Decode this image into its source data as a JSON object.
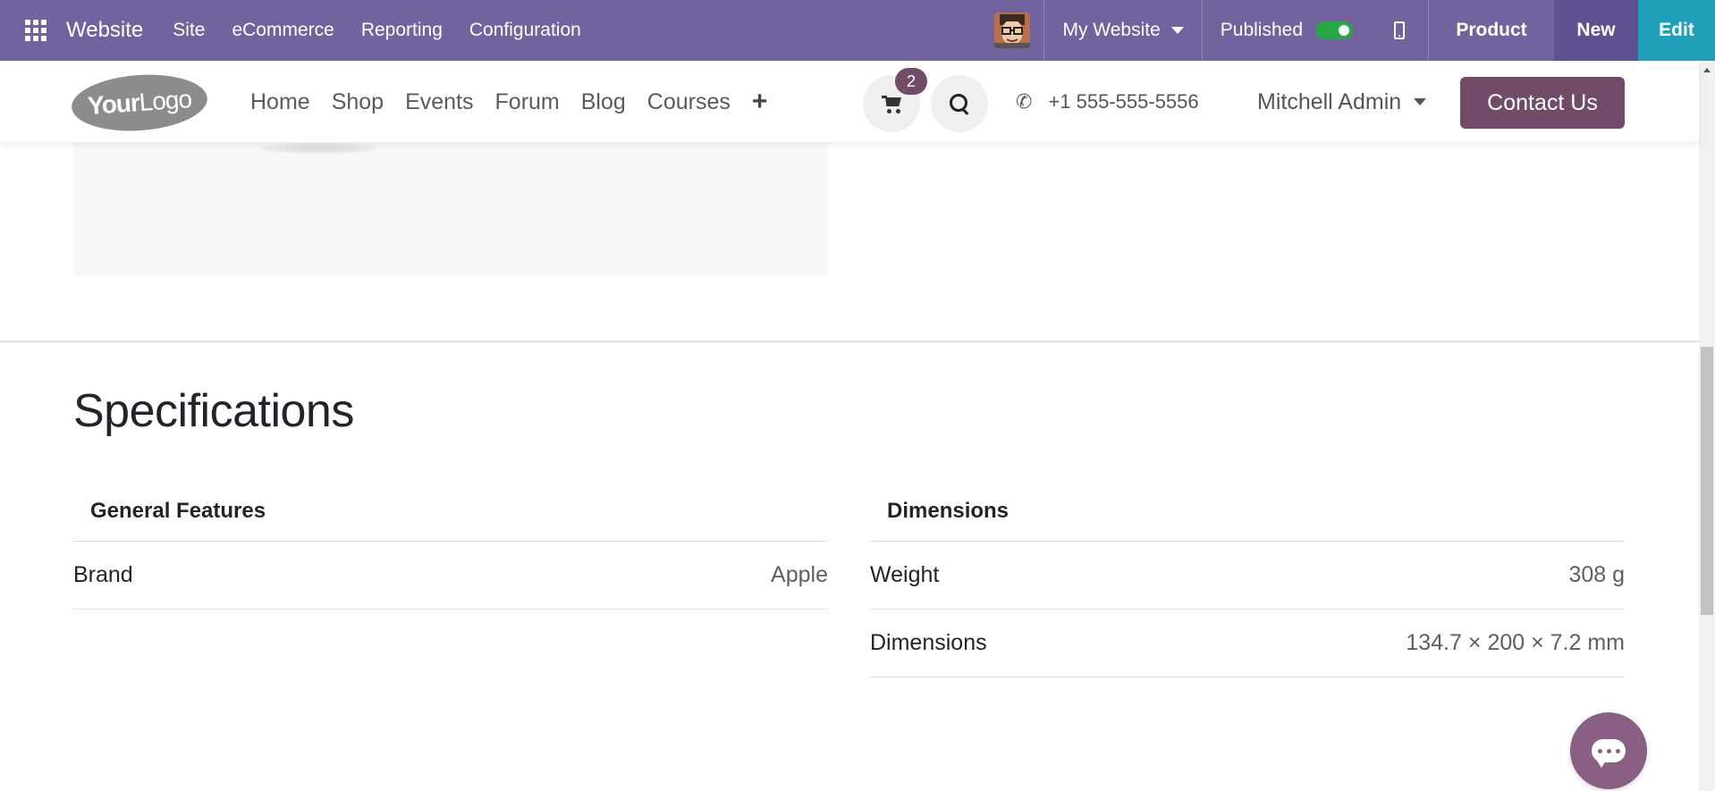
{
  "topbar": {
    "brand": "Website",
    "menu": [
      "Site",
      "eCommerce",
      "Reporting",
      "Configuration"
    ],
    "website_selector": "My Website",
    "published_label": "Published",
    "published": true,
    "product_label": "Product",
    "new_label": "New",
    "edit_label": "Edit",
    "colors": {
      "bar": "#71639e",
      "new": "#5f5192",
      "edit": "#1fa0b8",
      "toggle": "#28a745"
    }
  },
  "header": {
    "logo_text_bold": "Your",
    "logo_text": "Logo",
    "nav": [
      "Home",
      "Shop",
      "Events",
      "Forum",
      "Blog",
      "Courses"
    ],
    "add_icon": "+",
    "cart_count": "2",
    "phone": "+1 555-555-5556",
    "user": "Mitchell Admin",
    "contact_label": "Contact Us",
    "accent": "#714b67"
  },
  "specs": {
    "title": "Specifications",
    "left": {
      "heading": "General Features",
      "rows": [
        {
          "label": "Brand",
          "value": "Apple"
        }
      ]
    },
    "right": {
      "heading": "Dimensions",
      "rows": [
        {
          "label": "Weight",
          "value": "308 g"
        },
        {
          "label": "Dimensions",
          "value": "134.7 × 200 × 7.2 mm"
        }
      ]
    }
  },
  "icons": [
    "apps-grid-icon",
    "avatar-icon",
    "mobile-preview-icon",
    "cart-icon",
    "search-icon",
    "phone-icon",
    "chat-icon"
  ]
}
